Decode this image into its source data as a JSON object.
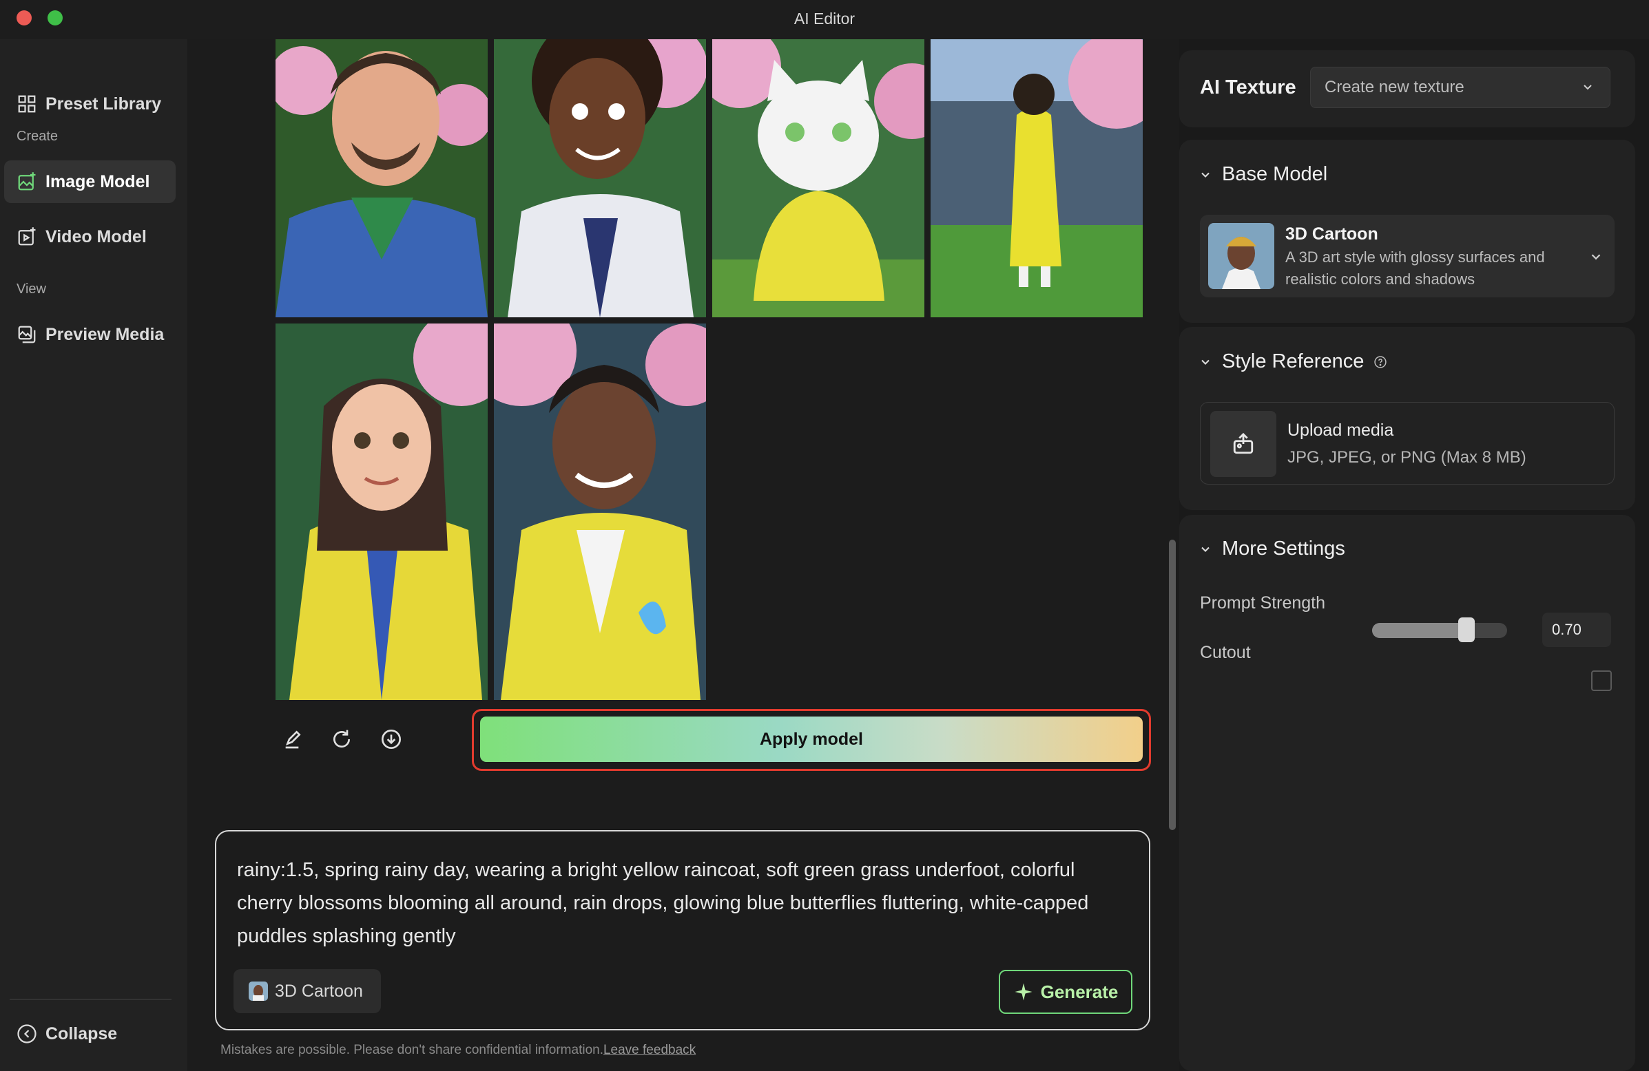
{
  "window": {
    "title": "AI Editor"
  },
  "sidebar": {
    "preset_library": "Preset Library",
    "create_label": "Create",
    "image_model": "Image Model",
    "video_model": "Video Model",
    "view_label": "View",
    "preview_media": "Preview Media",
    "collapse": "Collapse"
  },
  "gallery": {
    "images": [
      "man-green-blue-hoodie",
      "woman-white-jacket",
      "white-cat-yellow-raincoat",
      "child-yellow-raincoat-back",
      "woman-yellow-jacket",
      "man-yellow-jacket-butterfly"
    ],
    "tools": [
      "edit-icon",
      "refresh-icon",
      "download-icon"
    ]
  },
  "apply_button": "Apply model",
  "prompt": {
    "text": "rainy:1.5, spring rainy day, wearing a bright yellow raincoat, soft green grass underfoot, colorful cherry blossoms blooming all around, rain drops, glowing blue butterflies fluttering, white-capped puddles splashing gently",
    "model_chip": "3D Cartoon",
    "generate": "Generate"
  },
  "footer": {
    "disclaimer": "Mistakes are possible. Please don't share confidential information.",
    "feedback_link": "Leave feedback"
  },
  "right_panel": {
    "ai_texture": {
      "label": "AI Texture",
      "select_value": "Create new texture"
    },
    "base_model": {
      "title": "Base Model",
      "name": "3D Cartoon",
      "description": "A 3D art style with glossy surfaces and realistic colors and shadows"
    },
    "style_reference": {
      "title": "Style Reference",
      "upload_title": "Upload media",
      "upload_sub": "JPG, JPEG, or PNG (Max 8 MB)"
    },
    "more_settings": {
      "title": "More Settings",
      "prompt_strength_label": "Prompt Strength",
      "prompt_strength_value": "0.70",
      "prompt_strength_level": 0.7,
      "cutout_label": "Cutout",
      "cutout_checked": false
    }
  },
  "colors": {
    "accent_green": "#6fd77a",
    "highlight_red": "#e23b2e",
    "background": "#1c1c1c"
  }
}
